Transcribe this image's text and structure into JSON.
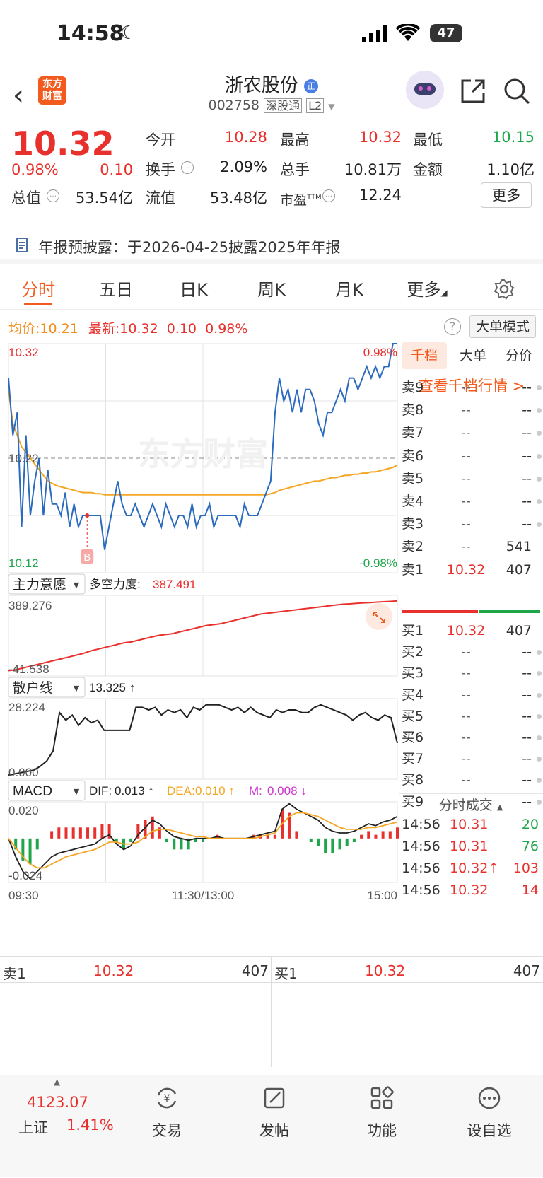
{
  "status": {
    "time": "14:58",
    "battery": "47"
  },
  "nav": {
    "logo_line1": "东方",
    "logo_line2": "财富",
    "stock_name": "浙农股份",
    "name_badge": "正",
    "code": "002758",
    "tag1": "深股通",
    "tag2": "L2"
  },
  "quote": {
    "price": "10.32",
    "change_pct": "0.98%",
    "change": "0.10",
    "open_label": "今开",
    "open": "10.28",
    "high_label": "最高",
    "high": "10.32",
    "low_label": "最低",
    "low": "10.15",
    "turnover_label": "换手",
    "turnover": "2.09%",
    "volume_label": "总手",
    "volume": "10.81万",
    "amount_label": "金额",
    "amount": "1.10亿",
    "mktcap_label": "总值",
    "mktcap": "53.54亿",
    "float_label": "流值",
    "float": "53.48亿",
    "pe_label": "市盈",
    "pe_sup": "TTM",
    "pe": "12.24",
    "more_button": "更多"
  },
  "notice": {
    "text": "年报预披露：于2026-04-25披露2025年年报"
  },
  "tabs": [
    "分时",
    "五日",
    "日K",
    "周K",
    "月K",
    "更多"
  ],
  "info_line": {
    "avg_label": "均价:",
    "avg": "10.21",
    "last_label": "最新:",
    "last": "10.32",
    "chg": "0.10",
    "pct": "0.98%",
    "big_order_button": "大单模式"
  },
  "chart_data": [
    {
      "type": "line",
      "title": "",
      "y_top_label": "10.32",
      "y_mid_label": "10.22",
      "y_bottom_label": "10.12",
      "pct_top_label": "0.98%",
      "pct_bottom_label": "-0.98%",
      "ylim": [
        10.12,
        10.32
      ],
      "prev_close": 10.22,
      "watermark": "东方财富",
      "buy_marker": "B",
      "series": [
        {
          "values": [
            10.29,
            10.24,
            10.26,
            10.16,
            10.24,
            10.17,
            10.2,
            10.22,
            10.17,
            10.21,
            10.18,
            10.18,
            10.17,
            10.19,
            10.16,
            10.18,
            10.16,
            10.17,
            10.17,
            10.17,
            10.17,
            10.17,
            10.14,
            10.16,
            10.18,
            10.2,
            10.18,
            10.17,
            10.17,
            10.18,
            10.17,
            10.16,
            10.17,
            10.18,
            10.17,
            10.16,
            10.18,
            10.17,
            10.16,
            10.17,
            10.17,
            10.16,
            10.18,
            10.16,
            10.17,
            10.17,
            10.18,
            10.16,
            10.17,
            10.17,
            10.17,
            10.17,
            10.17,
            10.16,
            10.18,
            10.17,
            10.17,
            10.17,
            10.18,
            10.19,
            10.2,
            10.26,
            10.29,
            10.27,
            10.28,
            10.26,
            10.28,
            10.26,
            10.28,
            10.28,
            10.27,
            10.25,
            10.24,
            10.26,
            10.26,
            10.27,
            10.28,
            10.27,
            10.29,
            10.29,
            10.28,
            10.29,
            10.3,
            10.29,
            10.3,
            10.29,
            10.3,
            10.3,
            10.32,
            10.32
          ]
        },
        {
          "values": [
            10.28,
            10.25,
            10.24,
            10.23,
            10.225,
            10.22,
            10.215,
            10.21,
            10.205,
            10.2,
            10.198,
            10.196,
            10.195,
            10.194,
            10.193,
            10.192,
            10.191,
            10.19,
            10.19,
            10.19,
            10.189,
            10.189,
            10.188,
            10.188,
            10.188,
            10.188,
            10.188,
            10.188,
            10.188,
            10.188,
            10.188,
            10.188,
            10.188,
            10.188,
            10.188,
            10.188,
            10.188,
            10.188,
            10.188,
            10.188,
            10.188,
            10.188,
            10.188,
            10.188,
            10.188,
            10.188,
            10.188,
            10.188,
            10.188,
            10.188,
            10.188,
            10.188,
            10.188,
            10.188,
            10.188,
            10.188,
            10.188,
            10.188,
            10.188,
            10.188,
            10.189,
            10.19,
            10.192,
            10.193,
            10.194,
            10.195,
            10.196,
            10.197,
            10.198,
            10.199,
            10.2,
            10.2,
            10.201,
            10.202,
            10.203,
            10.203,
            10.204,
            10.205,
            10.205,
            10.206,
            10.206,
            10.207,
            10.207,
            10.208,
            10.208,
            10.209,
            10.21,
            10.211,
            10.212,
            10.214
          ]
        }
      ]
    },
    {
      "type": "line",
      "indicator_button": "主力意愿",
      "label": "多空力度:",
      "value": "387.491",
      "y_top_label": "389.276",
      "y_bottom_label": "-41.538",
      "ylim": [
        -41.538,
        389.276
      ],
      "series": [
        {
          "values": [
            -35,
            -30,
            -20,
            -10,
            0,
            10,
            20,
            30,
            40,
            50,
            60,
            70,
            85,
            95,
            105,
            115,
            125,
            135,
            140,
            150,
            160,
            170,
            180,
            185,
            190,
            200,
            210,
            220,
            230,
            240,
            245,
            250,
            260,
            270,
            280,
            290,
            300,
            310,
            315,
            320,
            325,
            330,
            335,
            340,
            345,
            350,
            355,
            360,
            365,
            370,
            372,
            375,
            378,
            380,
            383,
            385,
            387,
            390
          ]
        }
      ]
    },
    {
      "type": "line",
      "indicator_button": "散户线",
      "value": "13.325 ↑",
      "y_top_label": "28.224",
      "y_bottom_label": "0.000",
      "ylim": [
        0,
        28.224
      ],
      "series": [
        {
          "values": [
            0.5,
            1,
            1.5,
            2,
            2.5,
            4,
            6,
            10,
            25,
            22,
            24,
            20,
            23,
            21,
            22,
            18,
            18,
            18,
            18,
            18,
            27,
            27,
            26,
            27,
            24,
            26,
            25,
            26,
            23,
            27,
            26,
            28,
            28,
            28,
            27,
            26,
            27,
            25,
            27,
            25,
            24,
            23,
            26,
            25,
            26,
            26,
            25,
            25,
            27,
            28,
            27,
            26,
            25,
            24,
            22,
            24,
            25,
            23,
            22,
            24,
            23,
            13
          ]
        }
      ]
    },
    {
      "type": "bar",
      "indicator_button": "MACD",
      "dif_label": "DIF:",
      "dif": "0.013 ↑",
      "dea_label": "DEA:",
      "dea": "0.010 ↑",
      "m_label": "M:",
      "m": "0.008 ↓",
      "y_top_label": "0.020",
      "y_bottom_label": "-0.024",
      "ylim": [
        -0.024,
        0.02
      ],
      "x_ticks": [
        "09:30",
        "11:30/13:00",
        "15:00"
      ],
      "series": [
        {
          "name": "DIF",
          "values": [
            0.0,
            -0.01,
            -0.018,
            -0.022,
            -0.018,
            -0.014,
            -0.01,
            -0.008,
            -0.007,
            -0.006,
            -0.005,
            -0.004,
            -0.003,
            0.0,
            0.002,
            -0.003,
            -0.006,
            -0.004,
            0.002,
            0.006,
            0.01,
            0.008,
            0.004,
            0.001,
            0.0,
            -0.001,
            0.0,
            0.0,
            0.0,
            0.001,
            0.0,
            0.0,
            0.0,
            0.0,
            0.001,
            0.002,
            0.003,
            0.004,
            0.016,
            0.019,
            0.016,
            0.014,
            0.012,
            0.01,
            0.006,
            0.004,
            0.003,
            0.003,
            0.004,
            0.006,
            0.008,
            0.007,
            0.009,
            0.01,
            0.012
          ]
        },
        {
          "name": "DEA",
          "values": [
            0.0,
            -0.005,
            -0.01,
            -0.014,
            -0.016,
            -0.016,
            -0.014,
            -0.012,
            -0.01,
            -0.009,
            -0.008,
            -0.007,
            -0.006,
            -0.004,
            -0.002,
            -0.002,
            -0.003,
            -0.003,
            -0.002,
            0.001,
            0.004,
            0.005,
            0.005,
            0.004,
            0.003,
            0.002,
            0.001,
            0.001,
            0.0,
            0.0,
            0.0,
            0.0,
            0.0,
            0.0,
            0.0,
            0.001,
            0.002,
            0.003,
            0.008,
            0.012,
            0.014,
            0.014,
            0.013,
            0.012,
            0.01,
            0.008,
            0.006,
            0.005,
            0.005,
            0.005,
            0.006,
            0.006,
            0.007,
            0.008,
            0.009
          ]
        },
        {
          "name": "M",
          "values": [
            0,
            -0.006,
            -0.012,
            -0.014,
            -0.006,
            0.0,
            0.004,
            0.006,
            0.006,
            0.006,
            0.006,
            0.006,
            0.006,
            0.008,
            0.008,
            -0.002,
            -0.006,
            -0.002,
            0.008,
            0.01,
            0.012,
            0.006,
            -0.002,
            -0.006,
            -0.006,
            -0.006,
            -0.002,
            -0.002,
            0.0,
            0.002,
            0.0,
            0.0,
            0.0,
            0.0,
            0.002,
            0.002,
            0.002,
            0.002,
            0.016,
            0.014,
            0.004,
            0.0,
            -0.002,
            -0.004,
            -0.008,
            -0.008,
            -0.006,
            -0.004,
            -0.002,
            0.002,
            0.004,
            0.002,
            0.004,
            0.004,
            0.006
          ]
        }
      ]
    }
  ],
  "orderbook": {
    "tabs": [
      "千档",
      "大单",
      "分价"
    ],
    "link": "查看千档行情 >",
    "sells": [
      {
        "label": "卖9",
        "price": "--",
        "vol": "--"
      },
      {
        "label": "卖8",
        "price": "--",
        "vol": "--"
      },
      {
        "label": "卖7",
        "price": "--",
        "vol": "--"
      },
      {
        "label": "卖6",
        "price": "--",
        "vol": "--"
      },
      {
        "label": "卖5",
        "price": "--",
        "vol": "--"
      },
      {
        "label": "卖4",
        "price": "--",
        "vol": "--"
      },
      {
        "label": "卖3",
        "price": "--",
        "vol": "--"
      },
      {
        "label": "卖2",
        "price": "--",
        "vol": "541"
      },
      {
        "label": "卖1",
        "price": "10.32",
        "vol": "407"
      }
    ],
    "buys": [
      {
        "label": "买1",
        "price": "10.32",
        "vol": "407"
      },
      {
        "label": "买2",
        "price": "--",
        "vol": "--"
      },
      {
        "label": "买3",
        "price": "--",
        "vol": "--"
      },
      {
        "label": "买4",
        "price": "--",
        "vol": "--"
      },
      {
        "label": "买5",
        "price": "--",
        "vol": "--"
      },
      {
        "label": "买6",
        "price": "--",
        "vol": "--"
      },
      {
        "label": "买7",
        "price": "--",
        "vol": "--"
      },
      {
        "label": "买8",
        "price": "--",
        "vol": "--"
      },
      {
        "label": "买9",
        "price": "--",
        "vol": "--"
      }
    ],
    "trades_title": "分时成交",
    "trades": [
      {
        "time": "14:56",
        "price": "10.31",
        "vol": "20",
        "dir": "green"
      },
      {
        "time": "14:56",
        "price": "10.31",
        "vol": "76",
        "dir": "green"
      },
      {
        "time": "14:56",
        "price": "10.32↑",
        "vol": "103",
        "dir": "red"
      },
      {
        "time": "14:56",
        "price": "10.32",
        "vol": "14",
        "dir": "red"
      }
    ]
  },
  "bottom_quote": {
    "sell_label": "卖1",
    "sell_price": "10.32",
    "sell_vol": "407",
    "buy_label": "买1",
    "buy_price": "10.32",
    "buy_vol": "407"
  },
  "tabbar": {
    "index_value": "4123.07",
    "index_name": "上证",
    "index_pct": "1.41%",
    "trade": "交易",
    "post": "发帖",
    "function": "功能",
    "watch": "设自选"
  },
  "colors": {
    "up": "#e8312d",
    "down": "#1ea64a",
    "accent": "#f25a1e",
    "price_line": "#2a6bbf",
    "avg_line": "#f5a623"
  }
}
